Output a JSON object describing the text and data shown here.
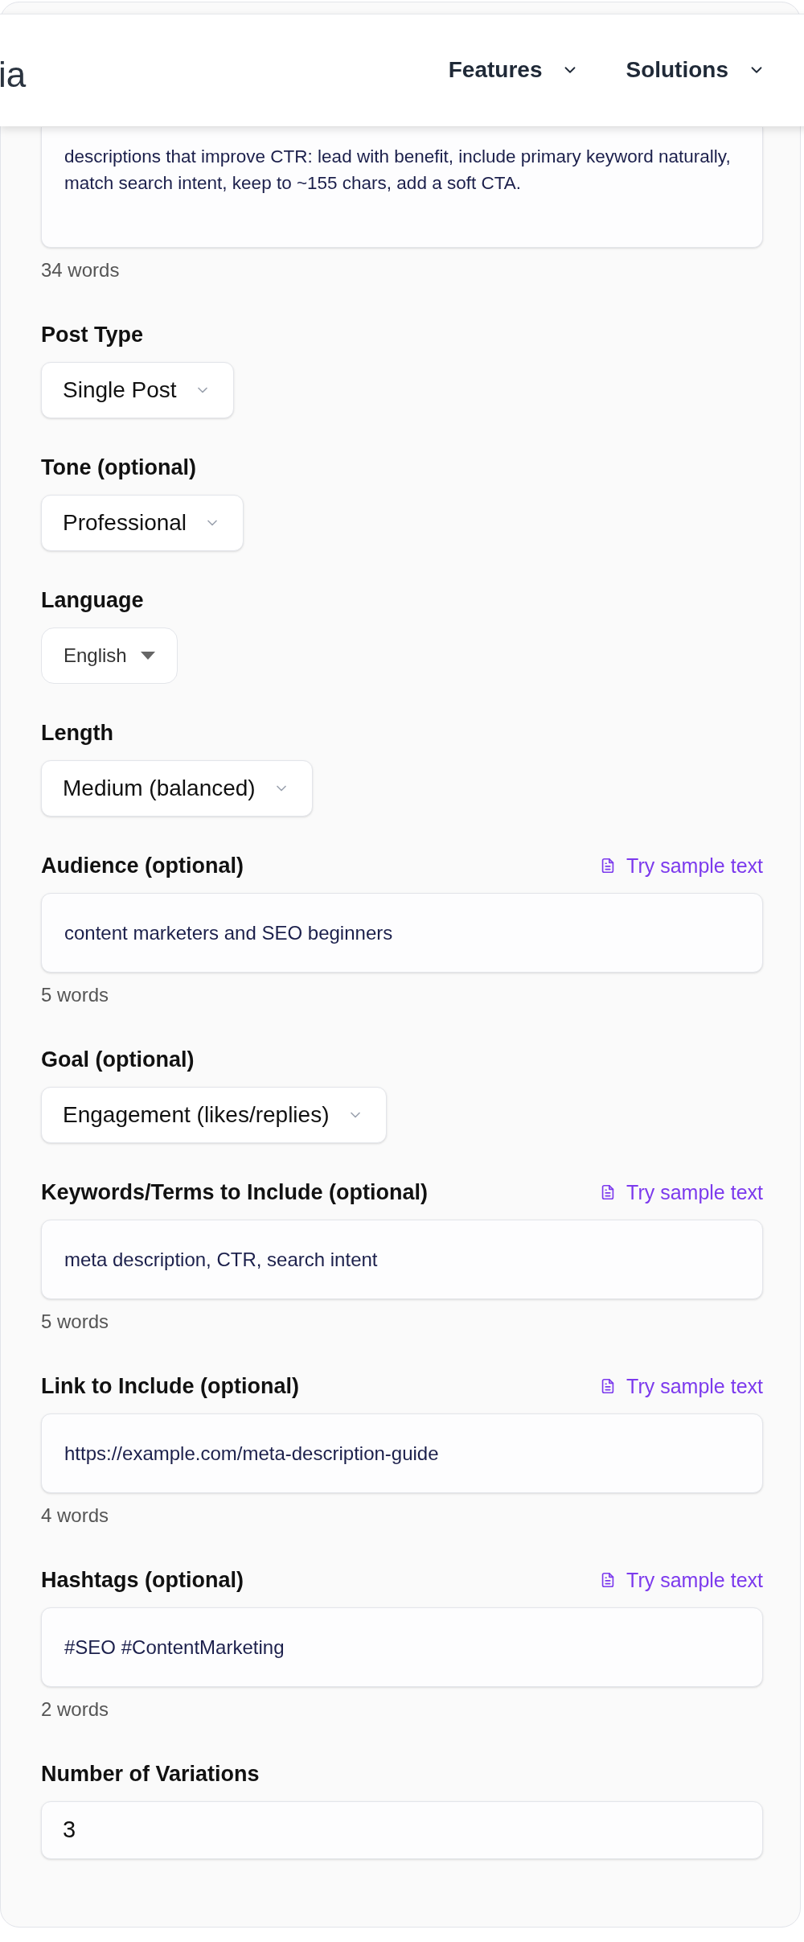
{
  "navbar": {
    "logo_text": "ia",
    "menu": [
      {
        "label": "Features"
      },
      {
        "label": "Solutions"
      }
    ]
  },
  "fields": [
    {
      "kind": "textarea",
      "value": "descriptions that improve CTR: lead with benefit, include primary keyword naturally, match search intent, keep to ~155 chars, add a soft CTA.",
      "word_count": "34 words"
    },
    {
      "kind": "select",
      "label": "Post Type",
      "value": "Single Post"
    },
    {
      "kind": "select",
      "label": "Tone (optional)",
      "value": "Professional"
    },
    {
      "kind": "native_select",
      "label": "Language",
      "value": "English"
    },
    {
      "kind": "select",
      "label": "Length",
      "value": "Medium (balanced)"
    },
    {
      "kind": "input",
      "label": "Audience (optional)",
      "action": "Try sample text",
      "value": "content marketers and SEO beginners",
      "word_count": "5 words"
    },
    {
      "kind": "select",
      "label": "Goal (optional)",
      "value": "Engagement (likes/replies)"
    },
    {
      "kind": "input",
      "label": "Keywords/Terms to Include (optional)",
      "action": "Try sample text",
      "value": "meta description, CTR, search intent",
      "word_count": "5 words"
    },
    {
      "kind": "input",
      "label": "Link to Include (optional)",
      "action": "Try sample text",
      "value": "https://example.com/meta-description-guide",
      "word_count": "4 words"
    },
    {
      "kind": "input",
      "label": "Hashtags (optional)",
      "action": "Try sample text",
      "value": "#SEO #ContentMarketing",
      "word_count": "2 words"
    },
    {
      "kind": "number",
      "label": "Number of Variations",
      "value": "3"
    }
  ]
}
